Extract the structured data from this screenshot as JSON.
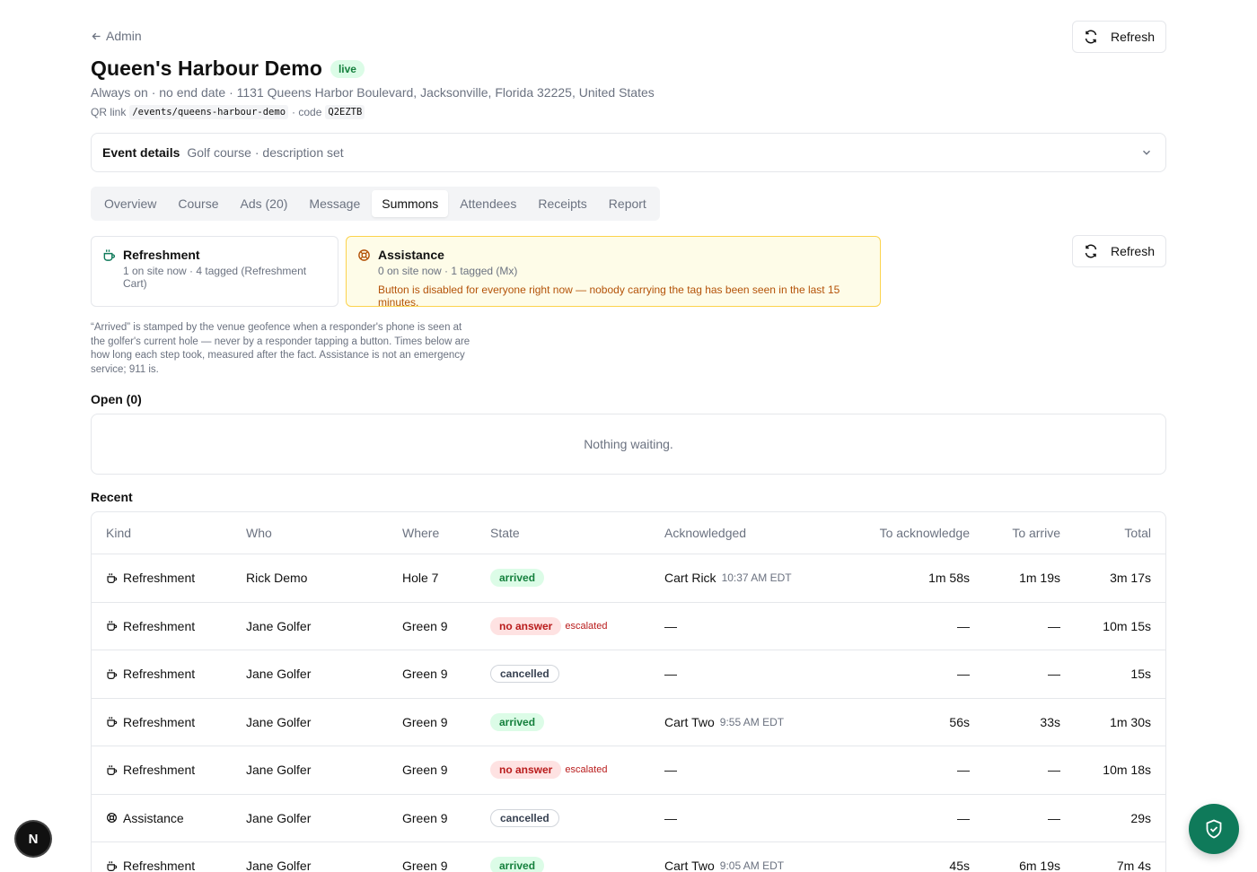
{
  "header": {
    "back_label": "Admin",
    "refresh_label": "Refresh",
    "title": "Queen's Harbour Demo",
    "status_badge": "live",
    "subtitle": "Always on · no end date · 1131 Queens Harbor Boulevard, Jacksonville, Florida 32225, United States",
    "qr_label": "QR link",
    "qr_path": "/events/queens-harbour-demo",
    "code_label": "· code",
    "code_value": "Q2EZTB"
  },
  "details": {
    "label": "Event details",
    "summary": "Golf course · description set"
  },
  "tabs": [
    "Overview",
    "Course",
    "Ads (20)",
    "Message",
    "Summons",
    "Attendees",
    "Receipts",
    "Report"
  ],
  "active_tab": "Summons",
  "summons": {
    "refresh_label": "Refresh",
    "cards": [
      {
        "title": "Refreshment",
        "sub": "1 on site now · 4 tagged (Refreshment Cart)",
        "icon": "cup-icon"
      },
      {
        "title": "Assistance",
        "sub": "0 on site now · 1 tagged (Mx)",
        "warning": "Button is disabled for everyone right now — nobody carrying the tag has been seen in the last 15 minutes.",
        "icon": "lifebuoy-icon"
      }
    ],
    "note": "“Arrived” is stamped by the venue geofence when a responder's phone is seen at the golfer's current hole — never by a responder tapping a button. Times below are how long each step took, measured after the fact. Assistance is not an emergency service; 911 is.",
    "open_heading": "Open (0)",
    "open_empty": "Nothing waiting.",
    "recent_heading": "Recent",
    "columns": {
      "kind": "Kind",
      "who": "Who",
      "where": "Where",
      "state": "State",
      "ack": "Acknowledged",
      "to_ack": "To acknowledge",
      "to_arrive": "To arrive",
      "total": "Total"
    },
    "rows": [
      {
        "kind": "Refreshment",
        "who": "Rick Demo",
        "where": "Hole 7",
        "state": "arrived",
        "escalated": "",
        "ack_by": "Cart Rick",
        "ack_time": "10:37 AM EDT",
        "to_ack": "1m 58s",
        "to_arrive": "1m 19s",
        "total": "3m 17s"
      },
      {
        "kind": "Refreshment",
        "who": "Jane Golfer",
        "where": "Green 9",
        "state": "no answer",
        "escalated": "escalated",
        "ack_by": "—",
        "ack_time": "",
        "to_ack": "—",
        "to_arrive": "—",
        "total": "10m 15s"
      },
      {
        "kind": "Refreshment",
        "who": "Jane Golfer",
        "where": "Green 9",
        "state": "cancelled",
        "escalated": "",
        "ack_by": "—",
        "ack_time": "",
        "to_ack": "—",
        "to_arrive": "—",
        "total": "15s"
      },
      {
        "kind": "Refreshment",
        "who": "Jane Golfer",
        "where": "Green 9",
        "state": "arrived",
        "escalated": "",
        "ack_by": "Cart Two",
        "ack_time": "9:55 AM EDT",
        "to_ack": "56s",
        "to_arrive": "33s",
        "total": "1m 30s"
      },
      {
        "kind": "Refreshment",
        "who": "Jane Golfer",
        "where": "Green 9",
        "state": "no answer",
        "escalated": "escalated",
        "ack_by": "—",
        "ack_time": "",
        "to_ack": "—",
        "to_arrive": "—",
        "total": "10m 18s"
      },
      {
        "kind": "Assistance",
        "who": "Jane Golfer",
        "where": "Green 9",
        "state": "cancelled",
        "escalated": "",
        "ack_by": "—",
        "ack_time": "",
        "to_ack": "—",
        "to_arrive": "—",
        "total": "29s"
      },
      {
        "kind": "Refreshment",
        "who": "Jane Golfer",
        "where": "Green 9",
        "state": "arrived",
        "escalated": "",
        "ack_by": "Cart Two",
        "ack_time": "9:05 AM EDT",
        "to_ack": "45s",
        "to_arrive": "6m 19s",
        "total": "7m 4s"
      }
    ]
  },
  "widgets": {
    "dev_badge": "N",
    "fab_icon": "shield-check-icon"
  },
  "colors": {
    "live_green": "#15803d",
    "warning_amber": "#b45309",
    "fab": "#0f7a5a",
    "danger": "#b91c1c"
  }
}
